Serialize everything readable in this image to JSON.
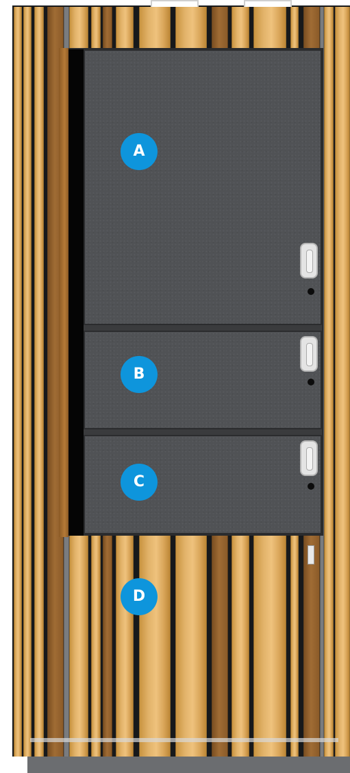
{
  "compartments": [
    {
      "id": "A",
      "label": "A",
      "kind": "door"
    },
    {
      "id": "B",
      "label": "B",
      "kind": "door"
    },
    {
      "id": "C",
      "label": "C",
      "kind": "door"
    },
    {
      "id": "D",
      "label": "D",
      "kind": "open-slatted-base"
    }
  ],
  "colors": {
    "badge": "#0e95dc",
    "felt_panel": "#505255",
    "light_wood": "#e2b36a",
    "dark_wood": "#a06c34",
    "handle": "#e4e4e4"
  }
}
